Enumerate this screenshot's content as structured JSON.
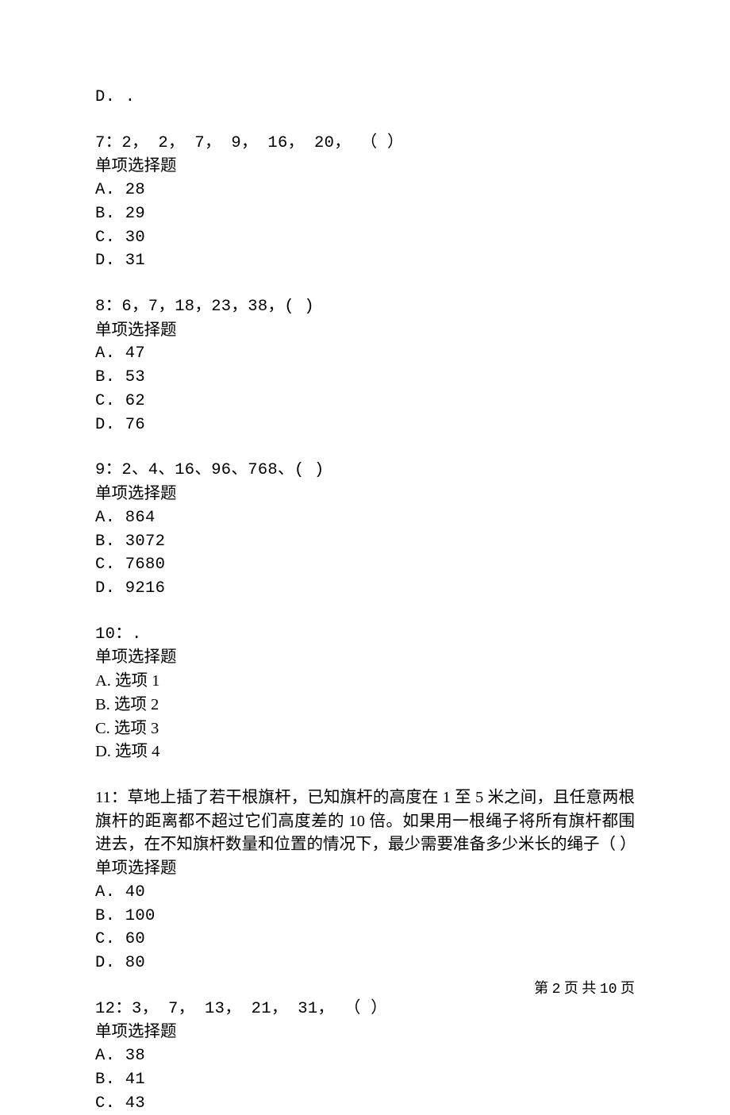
{
  "orphan": {
    "optD": "D. ."
  },
  "q7": {
    "stem": "7：2，  2，  7，  9，  16，  20，  （  ）",
    "type": "单项选择题",
    "A": "A. 28",
    "B": "B. 29",
    "C": "C. 30",
    "D": "D. 31"
  },
  "q8": {
    "stem": "8：6，7，18，23，38，(   )",
    "type": "单项选择题",
    "A": "A. 47",
    "B": "B. 53",
    "C": "C. 62",
    "D": "D. 76"
  },
  "q9": {
    "stem": "9：2、4、16、96、768、(   )",
    "type": "单项选择题",
    "A": "A. 864",
    "B": "B. 3072",
    "C": "C. 7680",
    "D": "D. 9216"
  },
  "q10": {
    "stem": "10：.",
    "type": "单项选择题",
    "A": "A. 选项 1",
    "B": "B. 选项 2",
    "C": "C. 选项 3",
    "D": "D. 选项 4"
  },
  "q11": {
    "stem": "11：草地上插了若干根旗杆，已知旗杆的高度在 1 至 5 米之间，且任意两根旗杆的距离都不超过它们高度差的 10 倍。如果用一根绳子将所有旗杆都围进去，在不知旗杆数量和位置的情况下，最少需要准备多少米长的绳子（ ）",
    "type": "单项选择题",
    "A": "A. 40",
    "B": "B. 100",
    "C": "C. 60",
    "D": "D. 80"
  },
  "q12": {
    "stem": "12：3，  7，  13，  21，  31，  （  ）",
    "type": "单项选择题",
    "A": "A. 38",
    "B": "B. 41",
    "C": "C. 43"
  },
  "footer": {
    "prefix": "第 ",
    "current": "2",
    "middle": " 页 共 ",
    "total": "10",
    "suffix": " 页"
  }
}
